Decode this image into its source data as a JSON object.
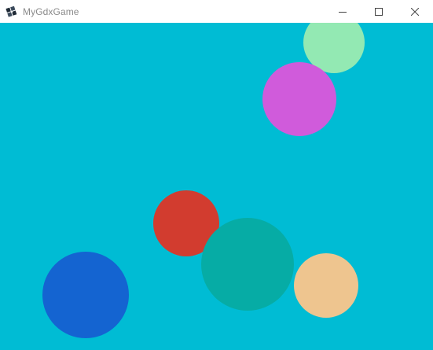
{
  "window": {
    "title": "MyGdxGame",
    "icons": {
      "app": "libgdx-app-icon",
      "minimize": "minimize-icon",
      "maximize": "maximize-icon",
      "close": "close-icon"
    }
  },
  "game": {
    "background_color": "#00BCD4",
    "balls": [
      {
        "name": "mint-ball",
        "color": "#93E9B3"
      },
      {
        "name": "violet-ball",
        "color": "#D05BDB"
      },
      {
        "name": "red-ball",
        "color": "#D23C2F"
      },
      {
        "name": "teal-ball",
        "color": "#06ACA5"
      },
      {
        "name": "peach-ball",
        "color": "#EEC58F"
      },
      {
        "name": "blue-ball",
        "color": "#1464D1"
      }
    ]
  }
}
